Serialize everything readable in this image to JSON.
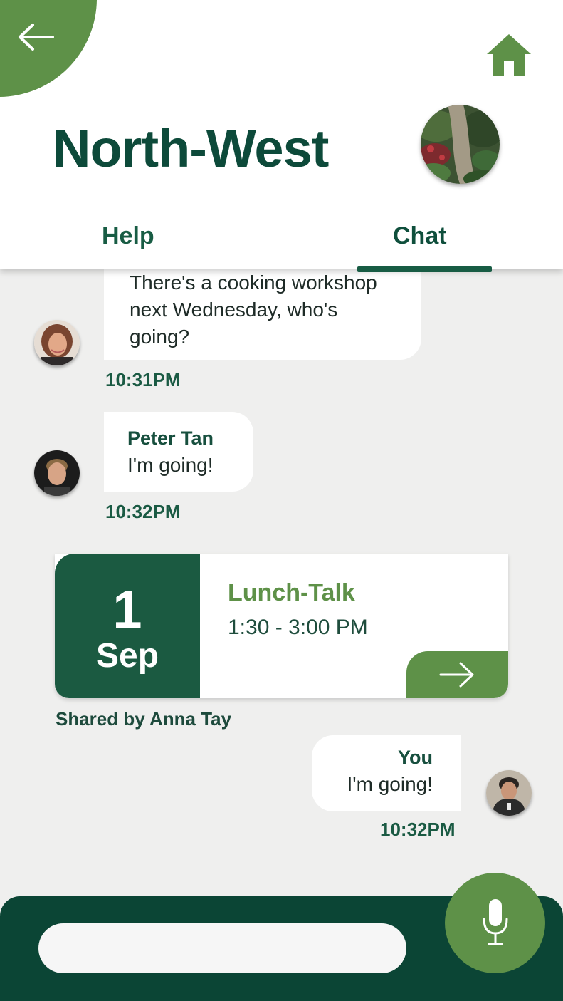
{
  "header": {
    "title": "North-West",
    "back_icon": "arrow-left-icon",
    "home_icon": "home-icon",
    "tabs": [
      {
        "label": "Help",
        "active": false
      },
      {
        "label": "Chat",
        "active": true
      }
    ]
  },
  "messages": [
    {
      "sender": "",
      "text": "There's a cooking workshop next Wednesday, who's going?",
      "time": "10:31PM"
    },
    {
      "sender": "Peter Tan",
      "text": "I'm going!",
      "time": "10:32PM"
    },
    {
      "sender": "You",
      "text": "I'm going!",
      "time": "10:32PM"
    }
  ],
  "event": {
    "day": "1",
    "month": "Sep",
    "title": "Lunch-Talk",
    "time": "1:30 - 3:00 PM",
    "shared_by": "Shared by Anna Tay",
    "open_icon": "arrow-right-icon"
  },
  "composer": {
    "placeholder": "",
    "mic_icon": "microphone-icon"
  },
  "colors": {
    "primary_dark": "#0b4535",
    "accent_green": "#5e9148",
    "text_green": "#185c44",
    "background": "#efefee"
  }
}
